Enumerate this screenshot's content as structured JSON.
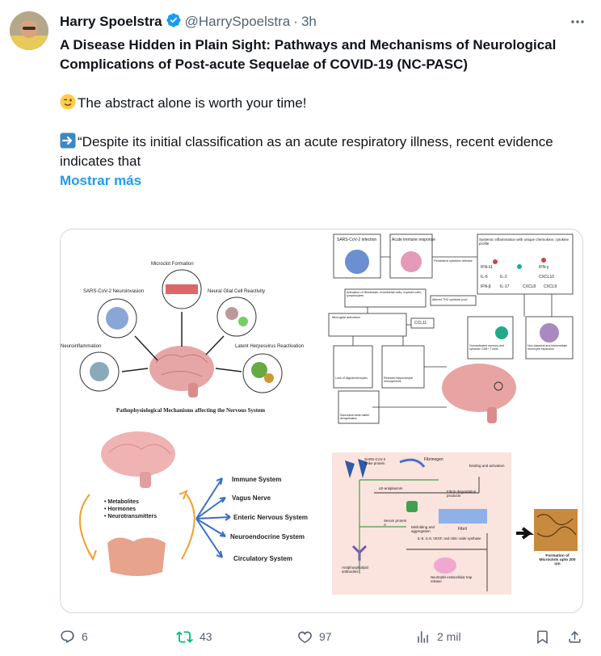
{
  "author": {
    "name": "Harry Spoelstra",
    "handle": "@HarrySpoelstra",
    "separator": "·",
    "time": "3h"
  },
  "post": {
    "title": "A Disease Hidden in Plain Sight: Pathways and Mechanisms of Neurological Complications of Post-acute Sequelae of COVID-19 (NC-PASC)",
    "line1": "The abstract alone is worth your time!",
    "line2": "“Despite its initial classification as an acute respiratory illness, recent evidence indicates that",
    "show_more": "Mostrar más"
  },
  "media": {
    "panel1": {
      "caption": "Pathophysiological Mechanisms affecting the Nervous System",
      "labels": [
        "Microclot Formation",
        "SARS-CoV-2 Neuroinvasion",
        "Neural Glial Cell Reactivity",
        "Neuroinflammation",
        "Latent Herpesvirus Reactivation"
      ]
    },
    "panel2": {
      "labels": [
        "SARS-CoV-2 infection",
        "Acute immune response",
        "Persistent cytokine release",
        "Systemic inflammation with unique chemokine, cytokine profile",
        "IFN-λ1",
        "IFN-γ",
        "IL-6",
        "IL-2",
        "CXCL10",
        "IFN-β",
        "IL-17",
        "CXCL8",
        "CXCL9",
        "Activation of fibroblasts, endothelial cells, myeloid cells, lymphocytes",
        "Altered TH2 cytokine pool",
        "Microglial activation",
        "CCL11",
        "Overactivated memory and cytotoxic CD8+ T cells",
        "Non-classical and intermediate monocyte expansion",
        "Loss of oligodendrocytes",
        "Reduced hippocampal neurogenesis",
        "Subcortical white matter demyelination"
      ]
    },
    "panel3": {
      "bullets": [
        "Metabolites",
        "Hormones",
        "Neurotransmitters"
      ],
      "systems": [
        "Immune System",
        "Vagus Nerve",
        "Enteric Nervous System",
        "Neuroendocrine System",
        "Circulatory System"
      ]
    },
    "panel4": {
      "labels": [
        "SARS-CoV-2 spike protein",
        "Fibrinogen",
        "binding and activation",
        "α2-antiplasmin",
        "Fibrin degradation products",
        "Serum protein A",
        "Misfolding and aggregation",
        "Fibril",
        "IL-6, IL-8, VEGF, and nitric oxide synthase",
        "Antiphospholipid antibodies",
        "Neutrophil extracellular trap release",
        "Formation of Microclots upto 200 um"
      ]
    }
  },
  "actions": {
    "replies": "6",
    "reposts": "43",
    "likes": "97",
    "views": "2 mil"
  },
  "colors": {
    "link": "#1d9bf0",
    "secondary": "#536471",
    "repost": "#00ba7c",
    "border": "#cfd9de"
  },
  "icons": [
    "verified-badge-icon",
    "more-icon",
    "wink-emoji",
    "arrow-right-emoji",
    "reply-icon",
    "repost-icon",
    "like-icon",
    "views-icon",
    "bookmark-icon",
    "share-icon"
  ]
}
